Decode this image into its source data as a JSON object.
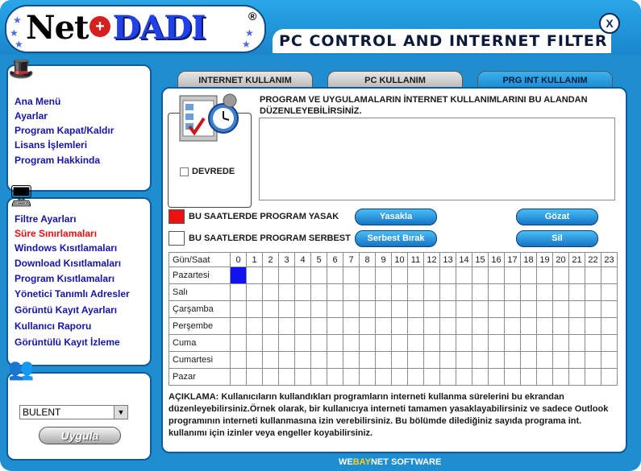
{
  "app": {
    "logo_net": "Net",
    "logo_dadi": "DADI",
    "logo_reg": "®",
    "title": "PC CONTROL AND INTERNET FILTER",
    "close_label": "X"
  },
  "sidebar": {
    "section1": [
      "Ana Menü",
      "Ayarlar",
      "Program Kapat/Kaldır",
      "Lisans İşlemleri",
      "Program Hakkinda"
    ],
    "section2": [
      "Filtre Ayarları",
      "Süre Sınırlamaları",
      "Windows Kısıtlamaları",
      "Download Kısıtlamaları",
      "Program Kısıtlamaları",
      "Yönetici Tanımlı Adresler",
      "Görüntü Kayıt Ayarları",
      "Kullanıcı Raporu",
      "Görüntülü Kayıt İzleme"
    ],
    "active_item": "Süre Sınırlamaları",
    "user_select": "BULENT",
    "apply_label": "Uygula"
  },
  "tabs": [
    "INTERNET KULLANIM",
    "PC KULLANIM",
    "PRG INT KULLANIM"
  ],
  "active_tab": "PRG INT KULLANIM",
  "content": {
    "description": "PROGRAM VE UYGULAMALARIN İNTERNET KULLANIMLARINI BU ALANDAN DÜZENLEYEBİLİRSİNİZ.",
    "devrede_label": "DEVREDE",
    "blocked_legend": "BU SAATLERDE PROGRAM YASAK",
    "allowed_legend": "BU SAATLERDE PROGRAM SERBEST",
    "buttons": {
      "yasakla": "Yasakla",
      "serbest": "Serbest Bırak",
      "gozat": "Gözat",
      "sil": "Sil"
    },
    "grid_header": "Gün/Saat",
    "hours": [
      "0",
      "1",
      "2",
      "3",
      "4",
      "5",
      "6",
      "7",
      "8",
      "9",
      "10",
      "11",
      "12",
      "13",
      "14",
      "15",
      "16",
      "17",
      "18",
      "19",
      "20",
      "21",
      "22",
      "23"
    ],
    "days": [
      "Pazartesi",
      "Salı",
      "Çarşamba",
      "Perşembe",
      "Cuma",
      "Cumartesi",
      "Pazar"
    ],
    "selected_cell": {
      "day": "Pazartesi",
      "hour": "0"
    },
    "note": "AÇIKLAMA: Kullanıcıların kullandıkları programların interneti kullanma sürelerini bu ekrandan düzenleyebilirsiniz.Örnek olarak, bir kullanıcıya interneti tamamen yasaklayabilirsiniz ve sadece Outlook programının interneti kullanmasına izin verebilirsiniz. Bu bölümde dilediğiniz sayıda programa int. kullanımı için izinler veya engeller koyabilirsiniz."
  },
  "footer": {
    "we": "WE",
    "bay": "BAY",
    "rest": "NET SOFTWARE"
  },
  "colors": {
    "blocked": "#ee1111",
    "allowed": "#ffffff",
    "selected_cell": "#1212ee",
    "frame": "#1e8ed0"
  }
}
